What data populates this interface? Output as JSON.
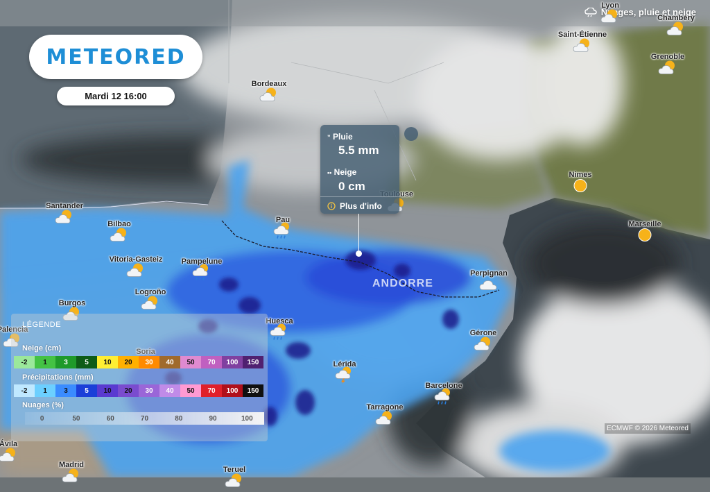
{
  "app": {
    "logo": "METEORED",
    "layer_title": "Nuages, pluie et neige",
    "date": "Mardi 12 16:00",
    "credit": "ECMWF © 2026 Meteored"
  },
  "popup": {
    "rain_label": "Pluie",
    "rain_value": "5.5 mm",
    "snow_label": "Neige",
    "snow_value": "0 cm",
    "more_label": "Plus d'info"
  },
  "region_label": "ANDORRE",
  "cities": [
    {
      "name": "Lyon",
      "icon": "cloud-sun-icon"
    },
    {
      "name": "Saint-Étienne",
      "icon": "cloud-sun-icon"
    },
    {
      "name": "Grenoble",
      "icon": "cloud-sun-icon"
    },
    {
      "name": "Chambéry",
      "icon": "cloud-sun-icon"
    },
    {
      "name": "Bordeaux",
      "icon": "cloud-sun-icon"
    },
    {
      "name": "Nimes",
      "icon": "sun-icon"
    },
    {
      "name": "Marseille",
      "icon": "sun-icon"
    },
    {
      "name": "Toulouse",
      "icon": "cloud-sun-icon"
    },
    {
      "name": "Santander",
      "icon": "cloud-sun-icon"
    },
    {
      "name": "Bilbao",
      "icon": "cloud-sun-icon"
    },
    {
      "name": "Pau",
      "icon": "rain-cloud-icon"
    },
    {
      "name": "Vitoria-Gasteiz",
      "icon": "cloud-sun-icon"
    },
    {
      "name": "Pampelune",
      "icon": "rain-cloud-icon"
    },
    {
      "name": "Logroño",
      "icon": "cloud-sun-icon"
    },
    {
      "name": "Burgos",
      "icon": "cloud-sun-icon"
    },
    {
      "name": "Perpignan",
      "icon": "cloud-icon"
    },
    {
      "name": "Huesca",
      "icon": "rain-cloud-icon"
    },
    {
      "name": "Gérone",
      "icon": "cloud-sun-icon"
    },
    {
      "name": "Palencia",
      "icon": "cloud-sun-icon"
    },
    {
      "name": "Soria",
      "icon": "cloud-sun-icon"
    },
    {
      "name": "Lérida",
      "icon": "thunder-cloud-icon"
    },
    {
      "name": "Barcelone",
      "icon": "rain-cloud-icon"
    },
    {
      "name": "Tarragone",
      "icon": "cloud-sun-icon"
    },
    {
      "name": "Ávila",
      "icon": "cloud-sun-icon"
    },
    {
      "name": "Madrid",
      "icon": "cloud-sun-icon"
    },
    {
      "name": "Teruel",
      "icon": "cloud-sun-icon"
    }
  ],
  "legend": {
    "title": "LÉGENDE",
    "snow": {
      "label": "Neige (cm)",
      "steps": [
        "-2",
        "1",
        "3",
        "5",
        "10",
        "20",
        "30",
        "40",
        "50",
        "70",
        "100",
        "150"
      ],
      "colors": [
        "#9be89b",
        "#44c244",
        "#1f9a2a",
        "#0e5c17",
        "#ffee33",
        "#ffb000",
        "#ff8a00",
        "#a06a2c",
        "#e08ad0",
        "#c060c0",
        "#8040a0",
        "#502070"
      ]
    },
    "rain": {
      "label": "Précipitations (mm)",
      "steps": [
        "-2",
        "1",
        "3",
        "5",
        "10",
        "20",
        "30",
        "40",
        "50",
        "70",
        "100",
        "150"
      ],
      "colors": [
        "#bfe8ff",
        "#6ccfff",
        "#3a8cff",
        "#1b3fd8",
        "#5a3ad0",
        "#7a4ccf",
        "#9a66d8",
        "#c08be8",
        "#ff9ad2",
        "#e0202a",
        "#b0101a",
        "#101010"
      ]
    },
    "clouds": {
      "label": "Nuages (%)",
      "steps": [
        "0",
        "50",
        "60",
        "70",
        "80",
        "90",
        "100"
      ]
    }
  }
}
